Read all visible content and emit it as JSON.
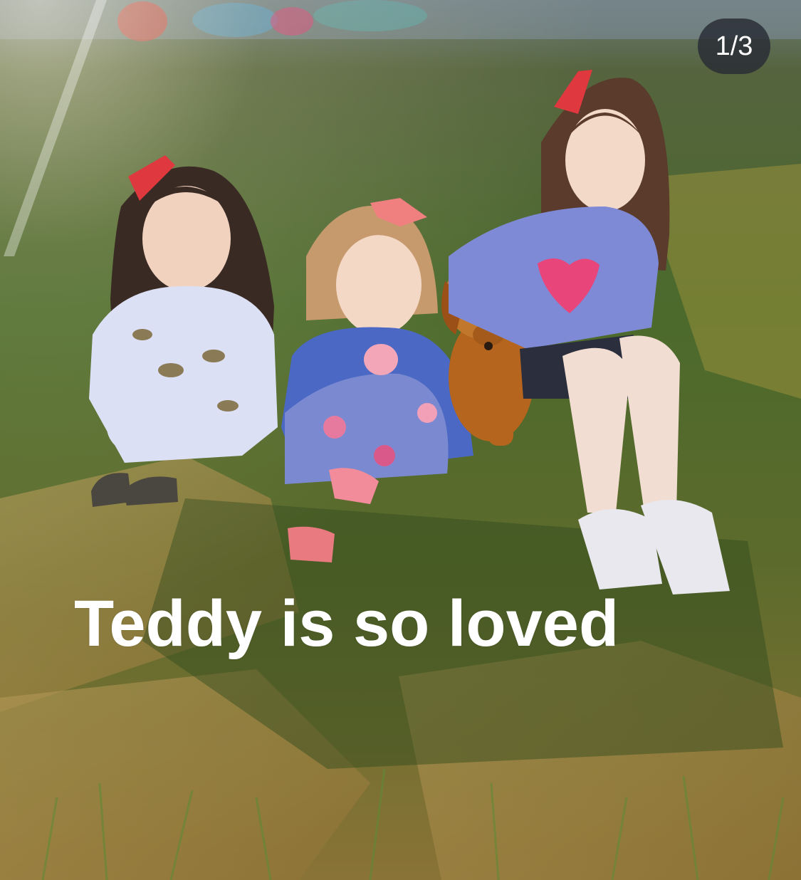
{
  "story": {
    "counter": "1/3",
    "caption": "Teddy is so loved"
  },
  "colors": {
    "counter_bg": "#2c3038",
    "caption_text": "#ffffff",
    "grass_dark": "#3f5a25",
    "grass_dry": "#a88a4a",
    "bow_red": "#e0383f"
  }
}
